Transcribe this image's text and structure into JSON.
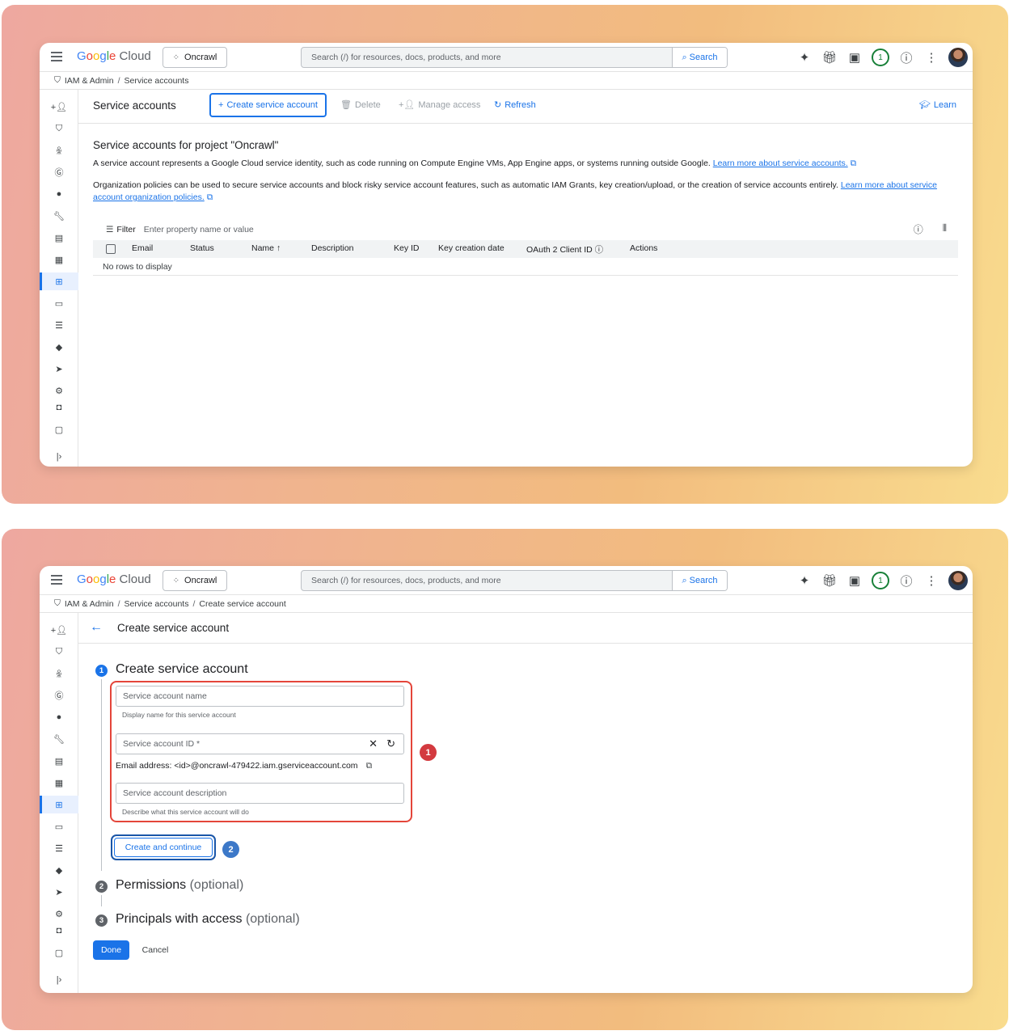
{
  "common": {
    "logo": {
      "g1": "G",
      "g2": "o",
      "g3": "o",
      "g4": "g",
      "g5": "l",
      "g6": "e",
      "cloud": " Cloud"
    },
    "project": "Oncrawl",
    "search_placeholder": "Search (/) for resources, docs, products, and more",
    "search_button": "Search",
    "notification_count": "1",
    "rail_icons": [
      "person-add-icon",
      "shield-icon",
      "person-search-icon",
      "policy-icon",
      "account-circle-icon",
      "wrench-icon",
      "receipt-icon",
      "note-icon",
      "service-account-icon",
      "card-icon",
      "list-icon",
      "tag-icon",
      "chevron-icon",
      "settings-icon",
      "camera-icon",
      "edit-note-icon",
      "expand-icon"
    ]
  },
  "screen1": {
    "breadcrumb": [
      "IAM & Admin",
      "Service accounts"
    ],
    "page_title": "Service accounts",
    "actions": {
      "create": "Create service account",
      "delete": "Delete",
      "manage_access": "Manage access",
      "refresh": "Refresh",
      "learn": "Learn"
    },
    "heading": "Service accounts for project \"Oncrawl\"",
    "para1_text": "A service account represents a Google Cloud service identity, such as code running on Compute Engine VMs, App Engine apps, or systems running outside Google. ",
    "para1_link": "Learn more about service accounts.",
    "para2_text": "Organization policies can be used to secure service accounts and block risky service account features, such as automatic IAM Grants, key creation/upload, or the creation of service accounts entirely. ",
    "para2_link": "Learn more about service account organization policies.",
    "filter_label": "Filter",
    "filter_placeholder": "Enter property name or value",
    "columns": [
      "Email",
      "Status",
      "Name",
      "Description",
      "Key ID",
      "Key creation date",
      "OAuth 2 Client ID",
      "Actions"
    ],
    "empty_text": "No rows to display"
  },
  "screen2": {
    "breadcrumb": [
      "IAM & Admin",
      "Service accounts",
      "Create service account"
    ],
    "header_title": "Create service account",
    "step1": {
      "num": "1",
      "title": "Create service account"
    },
    "name_placeholder": "Service account name",
    "name_helper": "Display name for this service account",
    "id_placeholder": "Service account ID *",
    "email_text": "Email address: <id>@oncrawl-479422.iam.gserviceaccount.com",
    "desc_placeholder": "Service account description",
    "desc_helper": "Describe what this service account will do",
    "create_continue": "Create and continue",
    "step2": {
      "num": "2",
      "title": "Permissions",
      "optional": "(optional)"
    },
    "step3": {
      "num": "3",
      "title": "Principals with access",
      "optional": "(optional)"
    },
    "done": "Done",
    "cancel": "Cancel",
    "annotations": {
      "a1": "1",
      "a2": "2"
    }
  },
  "colors": {
    "accent": "#1a73e8",
    "annotation_red": "#d33a3f",
    "annotation_blue": "#3c78c8"
  }
}
